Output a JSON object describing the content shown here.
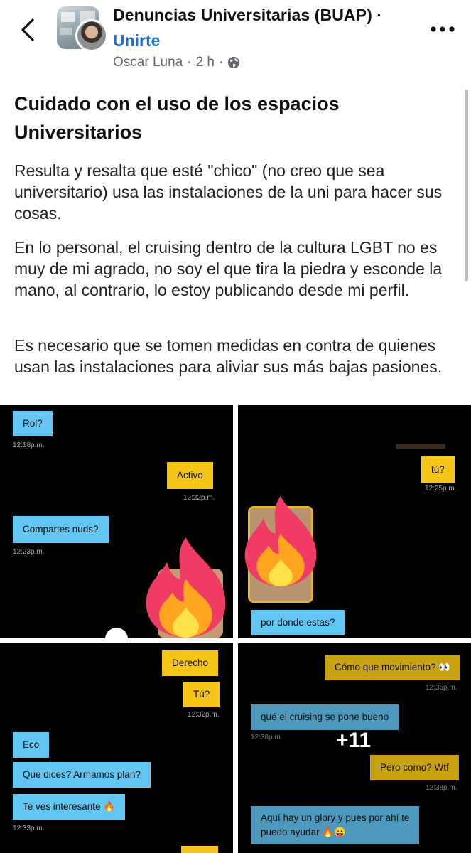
{
  "header": {
    "group_name": "Denuncias Universitarias (BUAP) ·",
    "join_label": "Unirte",
    "author": "Oscar Luna",
    "separator": "·",
    "time": "2 h",
    "separator2": "·"
  },
  "post": {
    "title": "Cuidado con el uso de los espacios Universitarios",
    "paragraphs": [
      "Resulta y resalta que esté \"chico\" (no creo que sea universitario) usa las instalaciones de la uni para hacer sus cosas.",
      "En lo personal, el cruising dentro de la cultura LGBT no es muy de mi agrado, no soy el que tira la piedra y esconde la mano, al contrario, lo estoy publicando desde mi perfil.",
      "Es necesario que se tomen medidas en contra de quienes usan las instalaciones para aliviar sus más bajas pasiones."
    ]
  },
  "images": {
    "panel1": {
      "m1": "Rol?",
      "t1": "12:18p.m.",
      "m2": "Activo",
      "t2": "12:22p.m.",
      "m3": "Compartes nuds?",
      "t3": "12:23p.m."
    },
    "panel2": {
      "m1": "tú?",
      "t1": "12:25p.m.",
      "m2": "por donde estas?"
    },
    "panel3": {
      "m1": "Derecho",
      "m2": "Tú?",
      "t2": "12:32p.m.",
      "m3": "Eco",
      "m4": "Que dices? Armamos plan?",
      "m5": "Te ves interesante 🔥",
      "t5": "12:33p.m."
    },
    "panel4": {
      "m1": "Cómo que movimiento? 👀",
      "t1": "12:35p.m.",
      "m2": "qué el cruising se pone bueno",
      "t2": "12:38p.m.",
      "m3": "Pero como? Wtf",
      "t3": "12:38p.m.",
      "m4a": "Aquí hay un glory y pues por ahí te",
      "m4b": "puedo ayudar 🔥😛",
      "more_count": "+11"
    }
  },
  "colors": {
    "link": "#1a6fd6",
    "bubble_blue": "#63c5f2",
    "bubble_yellow": "#f5c518",
    "bubble_yellow_dim": "#c9a211",
    "bubble_blue_dim": "#4d98bd"
  },
  "icons": [
    "back-arrow-icon",
    "globe-icon",
    "more-options-icon",
    "fire-emoji-icon"
  ]
}
